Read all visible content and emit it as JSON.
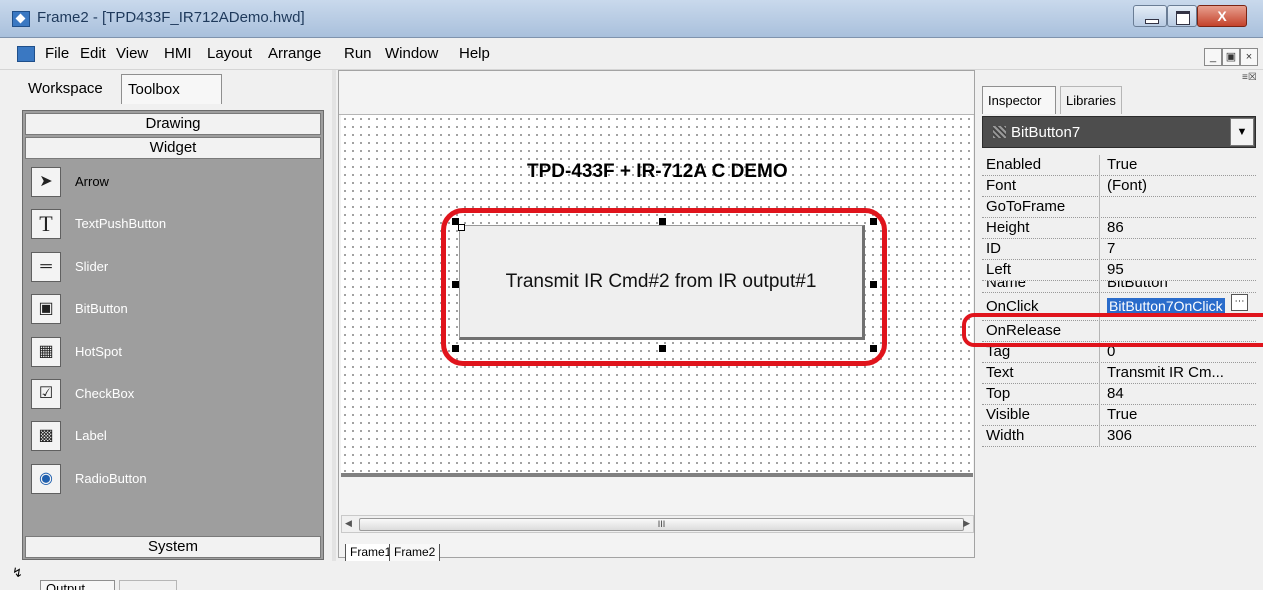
{
  "window": {
    "title": "Frame2 - [TPD433F_IR712ADemo.hwd]"
  },
  "menu": [
    "File",
    "Edit",
    "View",
    "HMI",
    "Layout",
    "Arrange",
    "Run",
    "Window",
    "Help"
  ],
  "left_panel": {
    "tabs": [
      "Workspace",
      "Toolbox"
    ],
    "active_tab": "Toolbox",
    "categories": {
      "drawing": "Drawing",
      "widget": "Widget",
      "system": "System"
    },
    "tools": [
      "Arrow",
      "TextPushButton",
      "Slider",
      "BitButton",
      "HotSpot",
      "CheckBox",
      "Label",
      "RadioButton"
    ],
    "selected_tool": "Arrow"
  },
  "designer": {
    "canvas_title": "TPD-433F + IR-712A   C DEMO",
    "button_text": "Transmit IR Cmd#2 from IR output#1",
    "scroll_grip": "III",
    "frame_tabs": [
      "Frame1",
      "Frame2"
    ],
    "active_frame": "Frame2"
  },
  "inspector": {
    "tabs": [
      "Inspector",
      "Libraries"
    ],
    "active_tab": "Inspector",
    "selected_object": "BitButton7",
    "properties": [
      {
        "name": "Enabled",
        "value": "True"
      },
      {
        "name": "Font",
        "value": "(Font)"
      },
      {
        "name": "GoToFrame",
        "value": ""
      },
      {
        "name": "Height",
        "value": "86"
      },
      {
        "name": "ID",
        "value": "7"
      },
      {
        "name": "Left",
        "value": "95"
      },
      {
        "name": "Name",
        "value": "BitButton"
      },
      {
        "name": "OnClick",
        "value": "BitButton7OnClick"
      },
      {
        "name": "OnRelease",
        "value": ""
      },
      {
        "name": "Tag",
        "value": "0"
      },
      {
        "name": "Text",
        "value": "Transmit IR Cm..."
      },
      {
        "name": "Top",
        "value": "84"
      },
      {
        "name": "Visible",
        "value": "True"
      },
      {
        "name": "Width",
        "value": "306"
      }
    ],
    "highlight_color": "#e0141c"
  },
  "bottom_tabs": [
    "Output"
  ],
  "colors": {
    "toolbox_bg": "#9e9e9e",
    "selection": "#2a6ccb",
    "annotation": "#e0141c"
  }
}
